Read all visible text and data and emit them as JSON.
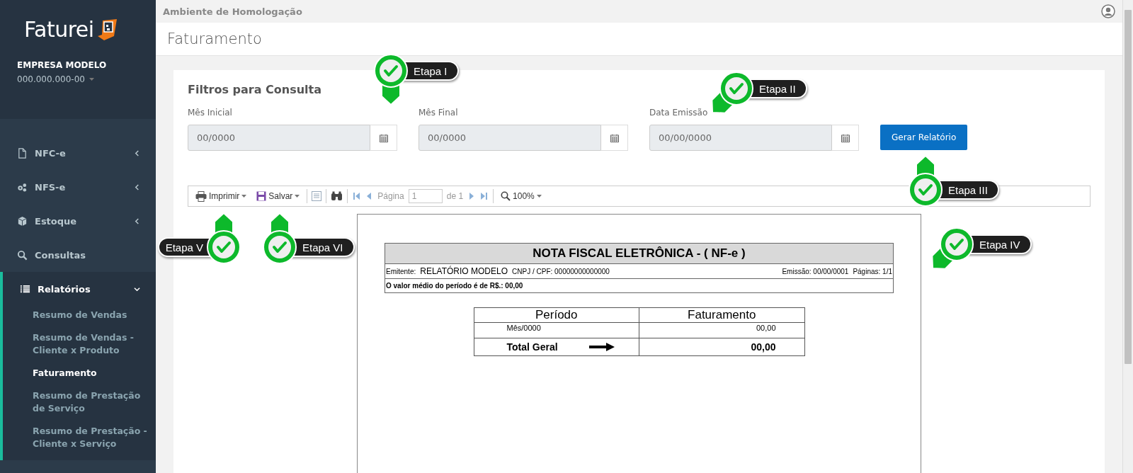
{
  "logo": {
    "text": "Faturei"
  },
  "company": {
    "name": "EMPRESA MODELO",
    "document": "000.000.000-00"
  },
  "menu": [
    {
      "label": "NFC-e",
      "kind": "file",
      "expanded": false
    },
    {
      "label": "NFS-e",
      "kind": "gears",
      "expanded": false
    },
    {
      "label": "Estoque",
      "kind": "cube",
      "expanded": false
    },
    {
      "label": "Consultas",
      "kind": "search"
    },
    {
      "label": "Relatórios",
      "kind": "list",
      "expanded": true,
      "children": [
        {
          "label": "Resumo de Vendas",
          "selected": false
        },
        {
          "label": "Resumo de Vendas - Cliente x Produto",
          "selected": false
        },
        {
          "label": "Faturamento",
          "selected": true
        },
        {
          "label": "Resumo de Prestação de Serviço",
          "selected": false
        },
        {
          "label": "Resumo de Prestação - Cliente x Serviço",
          "selected": false
        }
      ]
    }
  ],
  "environment": "Ambiente de Homologação",
  "page_title": "Faturamento",
  "filters": {
    "title": "Filtros para Consulta",
    "fields": [
      {
        "label": "Mês Inicial",
        "placeholder": "00/0000"
      },
      {
        "label": "Mês Final",
        "placeholder": "00/0000"
      },
      {
        "label": "Data Emissão",
        "placeholder": "00/00/0000"
      }
    ],
    "submit": "Gerar Relatório"
  },
  "toolbar": {
    "print": "Imprimir",
    "save": "Salvar",
    "page_label": "Página",
    "page_value": "1",
    "page_total": "de 1",
    "zoom": "100%"
  },
  "report": {
    "title": "NOTA FISCAL ELETRÔNICA - ( NF-e )",
    "issuer_label": "Emitente:",
    "issuer": "RELATÓRIO MODELO",
    "document": "CNPJ / CPF: 00000000000000",
    "issued": "Emissão: 00/00/0001",
    "pages": "Páginas: 1/1",
    "average": "O valor médio do período é de R$.: 00,00",
    "columns": [
      "Período",
      "Faturamento"
    ],
    "rows": [
      [
        "Mês/0000",
        "00,00"
      ]
    ],
    "total": {
      "label": "Total Geral",
      "value": "00,00"
    }
  },
  "callouts": [
    {
      "label": "Etapa I"
    },
    {
      "label": "Etapa II"
    },
    {
      "label": "Etapa III"
    },
    {
      "label": "Etapa V"
    },
    {
      "label": "Etapa VI"
    },
    {
      "label": "Etapa IV"
    }
  ]
}
